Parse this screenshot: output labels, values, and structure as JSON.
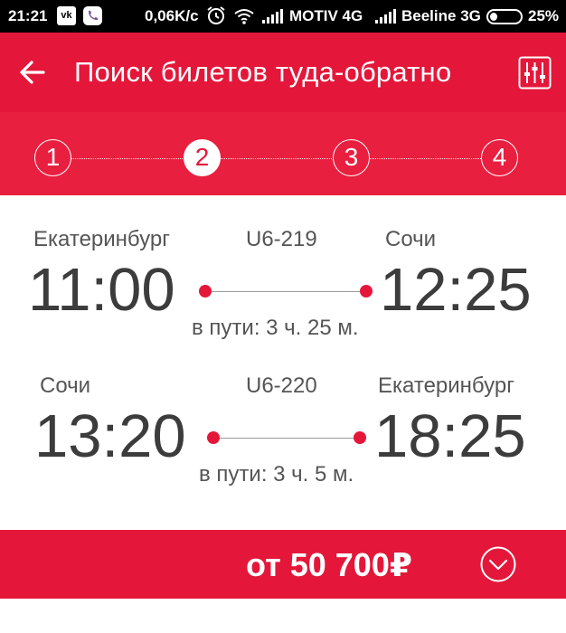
{
  "status_bar": {
    "time": "21:21",
    "vk_badge": "vk",
    "speed": "0,06K/c",
    "operator1": "MOTIV 4G",
    "operator2": "Beeline 3G",
    "battery_percent": "25%",
    "battery_level": 0.25,
    "icons": [
      "vk-icon",
      "viber-icon",
      "alarm-icon",
      "wifi-icon",
      "signal-icon",
      "signal-icon",
      "battery-icon"
    ]
  },
  "app_bar": {
    "title": "Поиск билетов туда-обратно",
    "back_icon": "arrow-left-icon",
    "filter_icon": "equalizer-icon"
  },
  "stepper": {
    "steps": [
      "1",
      "2",
      "3",
      "4"
    ],
    "active_step": 2
  },
  "flights": [
    {
      "from_city": "Екатеринбург",
      "flight_code": "U6-219",
      "to_city": "Сочи",
      "departure": "11:00",
      "arrival": "12:25",
      "duration": "в пути: 3 ч. 25 м."
    },
    {
      "from_city": "Сочи",
      "flight_code": "U6-220",
      "to_city": "Екатеринбург",
      "departure": "13:20",
      "arrival": "18:25",
      "duration": "в пути: 3 ч. 5 м."
    }
  ],
  "price_bar": {
    "price": "от 50 700₽",
    "expand_icon": "chevron-down-circle-icon"
  },
  "colors": {
    "primary": "#e4173a",
    "stepper_bg": "#e91f3f",
    "text_dark": "#3c3c3c",
    "text_secondary": "#555555"
  }
}
